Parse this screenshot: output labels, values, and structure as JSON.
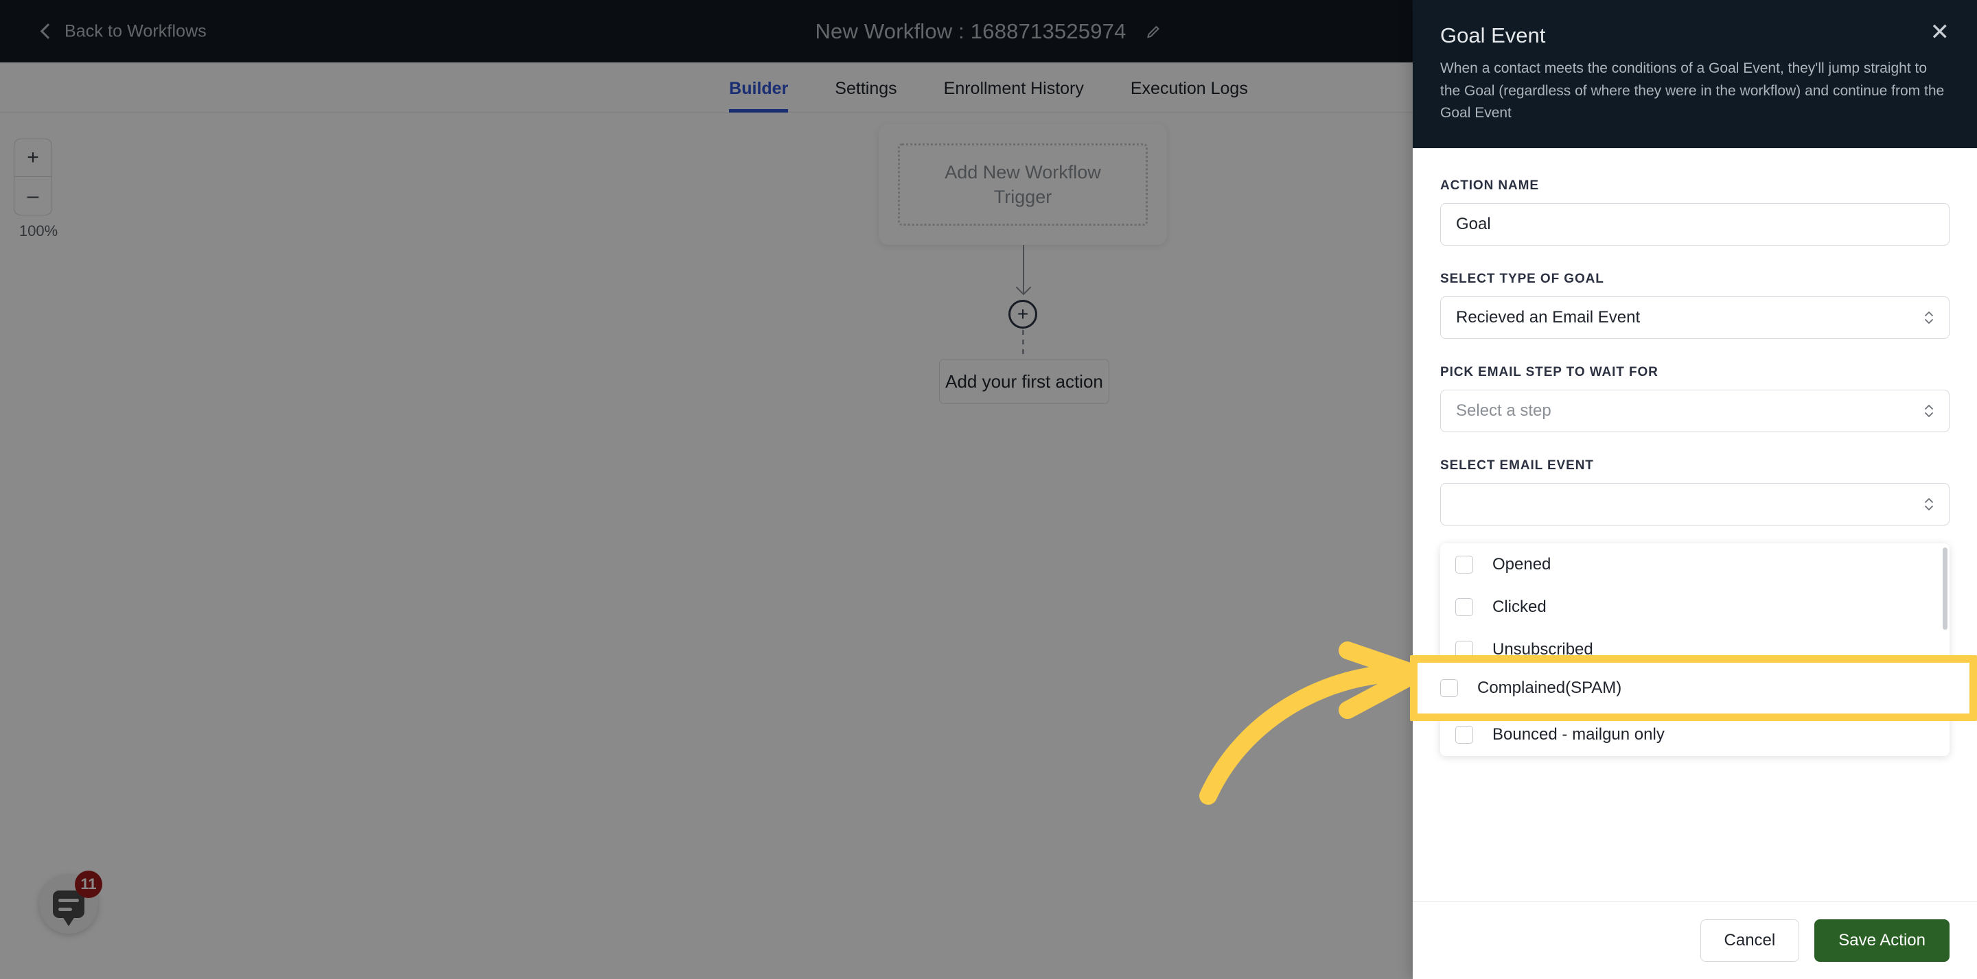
{
  "topbar": {
    "back_label": "Back to Workflows",
    "back_icon": "chevron-left-icon",
    "workflow_title": "New Workflow : 1688713525974",
    "edit_icon": "pencil-icon"
  },
  "tabs": [
    {
      "label": "Builder",
      "active": true
    },
    {
      "label": "Settings",
      "active": false
    },
    {
      "label": "Enrollment History",
      "active": false
    },
    {
      "label": "Execution Logs",
      "active": false
    }
  ],
  "canvas": {
    "zoom_in_label": "+",
    "zoom_out_label": "–",
    "zoom_level": "100%",
    "trigger_card_label": "Add New Workflow Trigger",
    "add_node_label": "+",
    "first_action_label": "Add your first action",
    "chat_badge_count": "11"
  },
  "panel": {
    "title": "Goal Event",
    "description": "When a contact meets the conditions of a Goal Event, they'll jump straight to the Goal (regardless of where they were in the workflow) and continue from the Goal Event",
    "close_label": "✕",
    "fields": {
      "action_name_label": "ACTION NAME",
      "action_name_value": "Goal",
      "goal_type_label": "SELECT TYPE OF GOAL",
      "goal_type_value": "Recieved an Email Event",
      "email_step_label": "PICK EMAIL STEP TO WAIT FOR",
      "email_step_placeholder": "Select a step",
      "email_event_label": "SELECT EMAIL EVENT",
      "email_event_value": ""
    },
    "email_events": [
      {
        "label": "Opened",
        "checked": false
      },
      {
        "label": "Clicked",
        "checked": false
      },
      {
        "label": "Unsubscribed",
        "checked": false
      },
      {
        "label": "Complained(SPAM)",
        "checked": false
      },
      {
        "label": "Bounced - mailgun only",
        "checked": false
      }
    ],
    "footer": {
      "cancel_label": "Cancel",
      "save_label": "Save Action"
    }
  },
  "annotation": {
    "highlighted_option": "Complained(SPAM)",
    "arrow_color": "#fbcd48",
    "highlight_border_color": "#fbcd48"
  },
  "colors": {
    "topbar_bg": "#141a22",
    "panel_head_bg": "#101a24",
    "accent_tab": "#2f55d4",
    "save_button": "#2a5f26",
    "badge_red": "#a01a1a"
  }
}
